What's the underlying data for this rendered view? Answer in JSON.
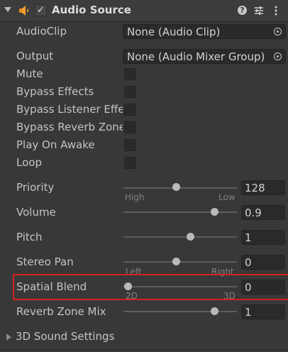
{
  "component": {
    "title": "Audio Source",
    "enabled": true
  },
  "icons": {
    "fold": "chevron-down-icon",
    "component": "audio-source-icon",
    "help": "help-icon",
    "preset": "preset-icon",
    "more": "more-options-icon"
  },
  "fields": {
    "audio_clip": {
      "label": "AudioClip",
      "value": "None (Audio Clip)"
    },
    "output": {
      "label": "Output",
      "value": "None (Audio Mixer Group)"
    },
    "mute": {
      "label": "Mute",
      "checked": false
    },
    "bypass_effects": {
      "label": "Bypass Effects",
      "checked": false
    },
    "bypass_listener": {
      "label": "Bypass Listener Effe",
      "checked": false
    },
    "bypass_reverb": {
      "label": "Bypass Reverb Zone",
      "checked": false
    },
    "play_on_awake": {
      "label": "Play On Awake",
      "checked": false
    },
    "loop": {
      "label": "Loop",
      "checked": false
    },
    "priority": {
      "label": "Priority",
      "value": "128",
      "min_label": "High",
      "max_label": "Low",
      "fraction": 0.5
    },
    "volume": {
      "label": "Volume",
      "value": "0.9",
      "fraction": 0.9
    },
    "pitch": {
      "label": "Pitch",
      "value": "1",
      "fraction": 0.65
    },
    "stereo_pan": {
      "label": "Stereo Pan",
      "value": "0",
      "min_label": "Left",
      "max_label": "Right",
      "fraction": 0.5
    },
    "spatial_blend": {
      "label": "Spatial Blend",
      "value": "0",
      "min_label": "2D",
      "max_label": "3D",
      "fraction": 0.0
    },
    "reverb_zone_mix": {
      "label": "Reverb Zone Mix",
      "value": "1",
      "fraction": 0.9
    }
  },
  "footer": {
    "label": "3D Sound Settings"
  },
  "colors": {
    "background": "#383838",
    "highlight": "#d42020"
  }
}
